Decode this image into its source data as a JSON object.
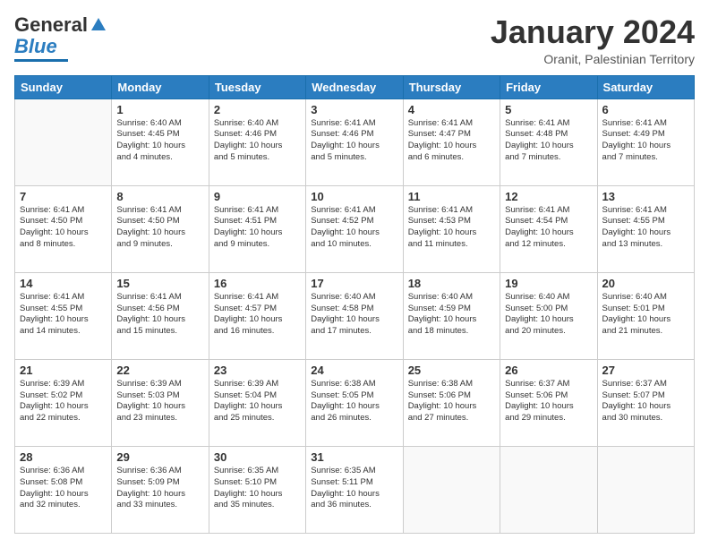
{
  "header": {
    "logo_general": "General",
    "logo_blue": "Blue",
    "month_title": "January 2024",
    "location": "Oranit, Palestinian Territory"
  },
  "days_of_week": [
    "Sunday",
    "Monday",
    "Tuesday",
    "Wednesday",
    "Thursday",
    "Friday",
    "Saturday"
  ],
  "weeks": [
    [
      {
        "day": "",
        "info": ""
      },
      {
        "day": "1",
        "info": "Sunrise: 6:40 AM\nSunset: 4:45 PM\nDaylight: 10 hours\nand 4 minutes."
      },
      {
        "day": "2",
        "info": "Sunrise: 6:40 AM\nSunset: 4:46 PM\nDaylight: 10 hours\nand 5 minutes."
      },
      {
        "day": "3",
        "info": "Sunrise: 6:41 AM\nSunset: 4:46 PM\nDaylight: 10 hours\nand 5 minutes."
      },
      {
        "day": "4",
        "info": "Sunrise: 6:41 AM\nSunset: 4:47 PM\nDaylight: 10 hours\nand 6 minutes."
      },
      {
        "day": "5",
        "info": "Sunrise: 6:41 AM\nSunset: 4:48 PM\nDaylight: 10 hours\nand 7 minutes."
      },
      {
        "day": "6",
        "info": "Sunrise: 6:41 AM\nSunset: 4:49 PM\nDaylight: 10 hours\nand 7 minutes."
      }
    ],
    [
      {
        "day": "7",
        "info": "Sunrise: 6:41 AM\nSunset: 4:50 PM\nDaylight: 10 hours\nand 8 minutes."
      },
      {
        "day": "8",
        "info": "Sunrise: 6:41 AM\nSunset: 4:50 PM\nDaylight: 10 hours\nand 9 minutes."
      },
      {
        "day": "9",
        "info": "Sunrise: 6:41 AM\nSunset: 4:51 PM\nDaylight: 10 hours\nand 9 minutes."
      },
      {
        "day": "10",
        "info": "Sunrise: 6:41 AM\nSunset: 4:52 PM\nDaylight: 10 hours\nand 10 minutes."
      },
      {
        "day": "11",
        "info": "Sunrise: 6:41 AM\nSunset: 4:53 PM\nDaylight: 10 hours\nand 11 minutes."
      },
      {
        "day": "12",
        "info": "Sunrise: 6:41 AM\nSunset: 4:54 PM\nDaylight: 10 hours\nand 12 minutes."
      },
      {
        "day": "13",
        "info": "Sunrise: 6:41 AM\nSunset: 4:55 PM\nDaylight: 10 hours\nand 13 minutes."
      }
    ],
    [
      {
        "day": "14",
        "info": "Sunrise: 6:41 AM\nSunset: 4:55 PM\nDaylight: 10 hours\nand 14 minutes."
      },
      {
        "day": "15",
        "info": "Sunrise: 6:41 AM\nSunset: 4:56 PM\nDaylight: 10 hours\nand 15 minutes."
      },
      {
        "day": "16",
        "info": "Sunrise: 6:41 AM\nSunset: 4:57 PM\nDaylight: 10 hours\nand 16 minutes."
      },
      {
        "day": "17",
        "info": "Sunrise: 6:40 AM\nSunset: 4:58 PM\nDaylight: 10 hours\nand 17 minutes."
      },
      {
        "day": "18",
        "info": "Sunrise: 6:40 AM\nSunset: 4:59 PM\nDaylight: 10 hours\nand 18 minutes."
      },
      {
        "day": "19",
        "info": "Sunrise: 6:40 AM\nSunset: 5:00 PM\nDaylight: 10 hours\nand 20 minutes."
      },
      {
        "day": "20",
        "info": "Sunrise: 6:40 AM\nSunset: 5:01 PM\nDaylight: 10 hours\nand 21 minutes."
      }
    ],
    [
      {
        "day": "21",
        "info": "Sunrise: 6:39 AM\nSunset: 5:02 PM\nDaylight: 10 hours\nand 22 minutes."
      },
      {
        "day": "22",
        "info": "Sunrise: 6:39 AM\nSunset: 5:03 PM\nDaylight: 10 hours\nand 23 minutes."
      },
      {
        "day": "23",
        "info": "Sunrise: 6:39 AM\nSunset: 5:04 PM\nDaylight: 10 hours\nand 25 minutes."
      },
      {
        "day": "24",
        "info": "Sunrise: 6:38 AM\nSunset: 5:05 PM\nDaylight: 10 hours\nand 26 minutes."
      },
      {
        "day": "25",
        "info": "Sunrise: 6:38 AM\nSunset: 5:06 PM\nDaylight: 10 hours\nand 27 minutes."
      },
      {
        "day": "26",
        "info": "Sunrise: 6:37 AM\nSunset: 5:06 PM\nDaylight: 10 hours\nand 29 minutes."
      },
      {
        "day": "27",
        "info": "Sunrise: 6:37 AM\nSunset: 5:07 PM\nDaylight: 10 hours\nand 30 minutes."
      }
    ],
    [
      {
        "day": "28",
        "info": "Sunrise: 6:36 AM\nSunset: 5:08 PM\nDaylight: 10 hours\nand 32 minutes."
      },
      {
        "day": "29",
        "info": "Sunrise: 6:36 AM\nSunset: 5:09 PM\nDaylight: 10 hours\nand 33 minutes."
      },
      {
        "day": "30",
        "info": "Sunrise: 6:35 AM\nSunset: 5:10 PM\nDaylight: 10 hours\nand 35 minutes."
      },
      {
        "day": "31",
        "info": "Sunrise: 6:35 AM\nSunset: 5:11 PM\nDaylight: 10 hours\nand 36 minutes."
      },
      {
        "day": "",
        "info": ""
      },
      {
        "day": "",
        "info": ""
      },
      {
        "day": "",
        "info": ""
      }
    ]
  ]
}
